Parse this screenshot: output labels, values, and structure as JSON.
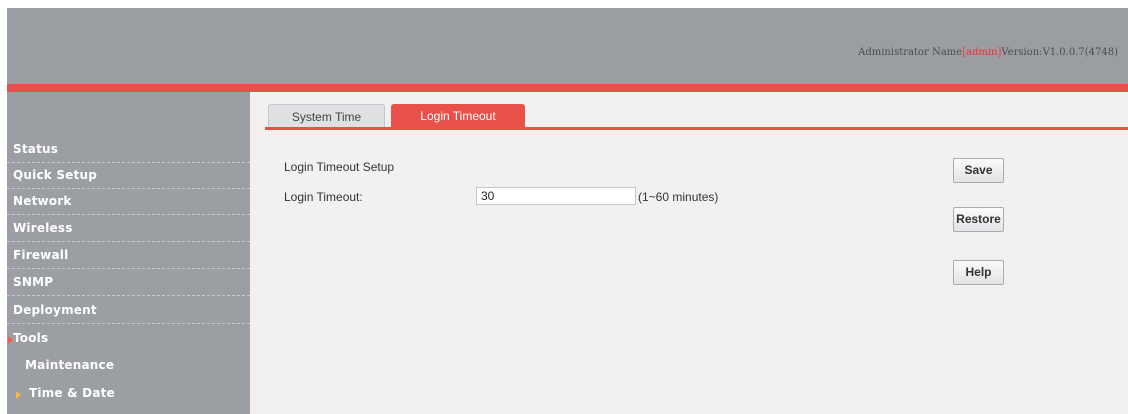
{
  "header": {
    "admin_prefix": "Administrator Name",
    "bracket_open": "[",
    "admin_name": "admin",
    "bracket_close": "]",
    "version_text": "Version:V1.0.0.7(4748)"
  },
  "sidebar": {
    "items": [
      {
        "label": "Status"
      },
      {
        "label": "Quick Setup"
      },
      {
        "label": "Network"
      },
      {
        "label": "Wireless"
      },
      {
        "label": "Firewall"
      },
      {
        "label": "SNMP"
      },
      {
        "label": "Deployment"
      },
      {
        "label": "Tools",
        "expanded": true
      },
      {
        "label": "Maintenance"
      },
      {
        "label": "Time & Date",
        "active": true
      }
    ]
  },
  "tabs": [
    {
      "label": "System Time"
    },
    {
      "label": "Login Timeout",
      "active": true
    }
  ],
  "form": {
    "title": "Login Timeout Setup",
    "timeout_label": "Login Timeout:",
    "timeout_value": "30",
    "timeout_hint": "(1~60 minutes)"
  },
  "buttons": {
    "save": "Save",
    "restore": "Restore",
    "help": "Help"
  },
  "colors": {
    "accent": "#e8504a",
    "header_bg": "#9a9da2",
    "sidebar_bg": "#9b9ea3",
    "content_bg": "#f3f1ef"
  }
}
